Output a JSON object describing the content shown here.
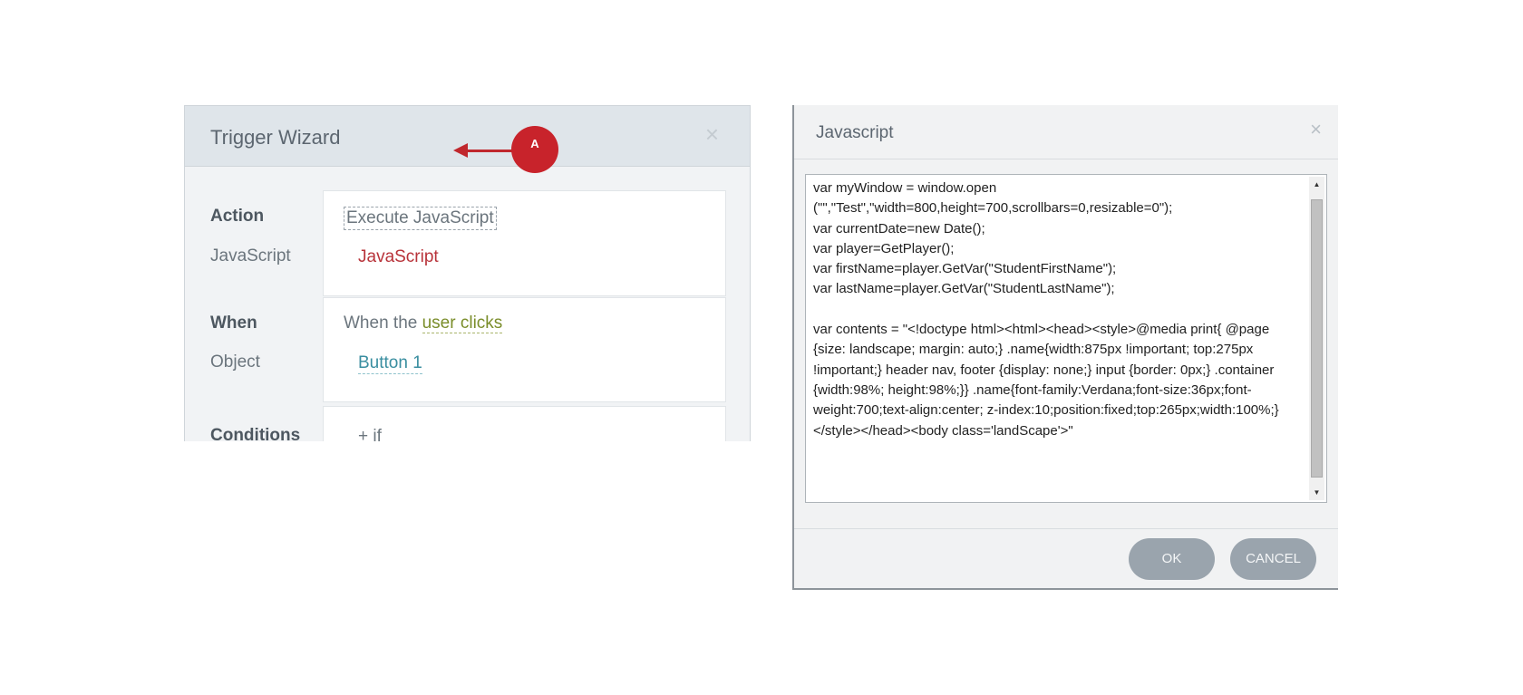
{
  "trigger_wizard": {
    "title": "Trigger Wizard",
    "close_glyph": "×",
    "action_label": "Action",
    "action_value": "Execute JavaScript",
    "javascript_label": "JavaScript",
    "javascript_value": "JavaScript",
    "when_label": "When",
    "when_prefix": "When the ",
    "when_value": "user clicks",
    "object_label": "Object",
    "object_value": "Button 1",
    "conditions_label": "Conditions",
    "conditions_value": "+ if"
  },
  "annotation": {
    "badge_label": "A",
    "color": "#c8232b"
  },
  "javascript_dialog": {
    "title": "Javascript",
    "close_glyph": "×",
    "code": "var myWindow = window.open\n(\"\",\"Test\",\"width=800,height=700,scrollbars=0,resizable=0\");\nvar currentDate=new Date();\nvar player=GetPlayer();\nvar firstName=player.GetVar(\"StudentFirstName\");\nvar lastName=player.GetVar(\"StudentLastName\");\n\nvar contents = \"<!doctype html><html><head><style>@media print{ @page {size: landscape; margin: auto;} .name{width:875px !important; top:275px !important;} header nav, footer {display: none;} input {border: 0px;} .container  {width:98%; height:98%;}} .name{font-family:Verdana;font-size:36px;font-weight:700;text-align:center; z-index:10;position:fixed;top:265px;width:100%;} </style></head><body class='landScape'>\"",
    "ok_label": "OK",
    "cancel_label": "CANCEL",
    "scroll_up_glyph": "▲",
    "scroll_down_glyph": "▼"
  }
}
